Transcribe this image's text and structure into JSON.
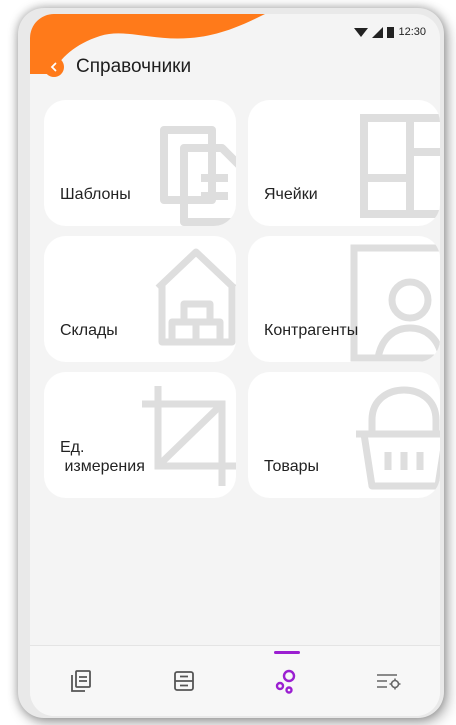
{
  "status_bar": {
    "time": "12:30"
  },
  "header": {
    "title": "Справочники"
  },
  "cards": [
    {
      "label_lines": [
        "Шаблоны"
      ],
      "icon": "templates-icon"
    },
    {
      "label_lines": [
        "Ячейки"
      ],
      "icon": "cells-icon"
    },
    {
      "label_lines": [
        "Склады"
      ],
      "icon": "warehouse-icon"
    },
    {
      "label_lines": [
        "Контрагенты"
      ],
      "icon": "contractor-icon"
    },
    {
      "label_lines": [
        "Ед.",
        " измерения"
      ],
      "icon": "measure-icon"
    },
    {
      "label_lines": [
        "Товары"
      ],
      "icon": "basket-icon"
    }
  ],
  "bottom_nav": [
    {
      "icon": "documents-icon",
      "active": false
    },
    {
      "icon": "storage-icon",
      "active": false
    },
    {
      "icon": "directories-icon",
      "active": true
    },
    {
      "icon": "settings-list-icon",
      "active": false
    }
  ],
  "colors": {
    "accent": "#ff7a1a",
    "active": "#9b1fd1",
    "card_bg": "#ffffff",
    "screen_bg": "#f4f4f4"
  }
}
